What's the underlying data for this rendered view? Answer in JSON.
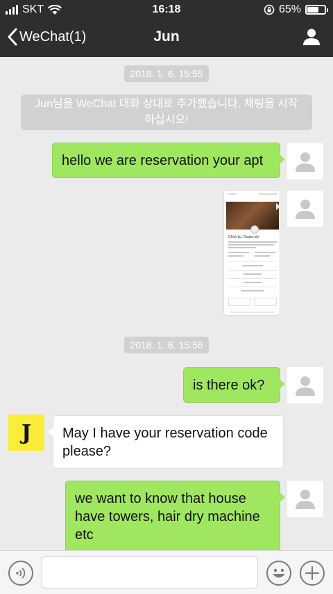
{
  "status_bar": {
    "carrier": "SKT",
    "time": "16:18",
    "battery_text": "65%",
    "battery_level": 0.65
  },
  "nav": {
    "back_label": "WeChat(1)",
    "title": "Jun"
  },
  "colors": {
    "bar_bg": "#2e2e30",
    "chat_bg": "#ebebeb",
    "outgoing_bubble": "#9fe75f",
    "incoming_bubble": "#ffffff",
    "contact_avatar": "#f9ed3a"
  },
  "chat": {
    "timestamp_1": "2018. 1. 6. 15:55",
    "system_message": "Jun님을 WeChat 대화 상대로 추가했습니다. 채팅을 시작하십시오!",
    "msg_1": "hello we are reservation your apt",
    "image_msg": {
      "location_text": "Chūō-ku, Ōsaka-shi"
    },
    "timestamp_2": "2018. 1. 6. 15:56",
    "msg_2": "is there ok?",
    "contact_avatar_letter": "J",
    "msg_3": "May I have your reservation code please?",
    "msg_4": "we want to know that house have towers, hair dry machine etc"
  },
  "input": {
    "placeholder": ""
  },
  "icons": [
    "back-chevron-icon",
    "wifi-icon",
    "signal-icon",
    "orientation-lock-icon",
    "battery-icon",
    "profile-icon",
    "default-avatar-icon",
    "voice-icon",
    "emoji-icon",
    "plus-icon"
  ]
}
